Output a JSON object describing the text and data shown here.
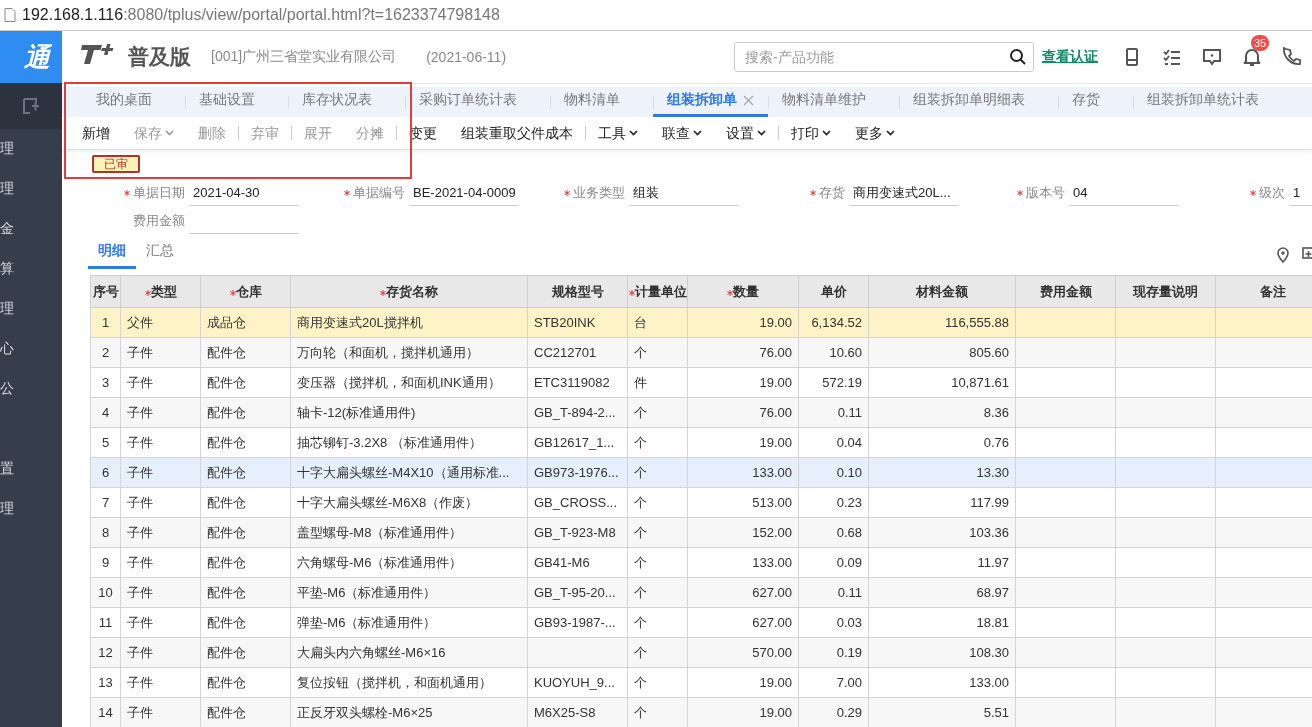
{
  "browser": {
    "url_host": "192.168.1.116",
    "url_rest": ":8080/tplus/view/portal/portal.html?t=1623374798148"
  },
  "sidebar": {
    "logo": "通",
    "groups": [
      [
        "理",
        "理",
        "金",
        "算",
        "理",
        "心",
        "公"
      ],
      [
        "置",
        "理"
      ]
    ]
  },
  "header": {
    "product": "普及版",
    "company": "[001]广州三省堂实业有限公司",
    "date": "(2021-06-11)",
    "search_placeholder": "搜索-产品功能",
    "link": "查看认证",
    "notification_count": "35"
  },
  "tabs": [
    {
      "label": "我的桌面",
      "selected": false,
      "closable": false
    },
    {
      "label": "基础设置",
      "selected": false,
      "closable": false
    },
    {
      "label": "库存状况表",
      "selected": false,
      "closable": false
    },
    {
      "label": "采购订单统计表",
      "selected": false,
      "closable": false
    },
    {
      "label": "物料清单",
      "selected": false,
      "closable": false
    },
    {
      "label": "组装拆卸单",
      "selected": true,
      "closable": true
    },
    {
      "label": "物料清单维护",
      "selected": false,
      "closable": false
    },
    {
      "label": "组装拆卸单明细表",
      "selected": false,
      "closable": false
    },
    {
      "label": "存货",
      "selected": false,
      "closable": false
    },
    {
      "label": "组装拆卸单统计表",
      "selected": false,
      "closable": false
    }
  ],
  "toolbar": [
    [
      {
        "label": "新增",
        "disabled": false,
        "dropdown": false
      },
      {
        "label": "保存",
        "disabled": true,
        "dropdown": true
      },
      {
        "label": "删除",
        "disabled": true,
        "dropdown": false
      }
    ],
    [
      {
        "label": "弃审",
        "disabled": true,
        "dropdown": false
      }
    ],
    [
      {
        "label": "展开",
        "disabled": true,
        "dropdown": false
      },
      {
        "label": "分摊",
        "disabled": true,
        "dropdown": false
      }
    ],
    [
      {
        "label": "变更",
        "disabled": false,
        "dropdown": false
      },
      {
        "label": "组装重取父件成本",
        "disabled": false,
        "dropdown": false
      }
    ],
    [
      {
        "label": "工具",
        "disabled": false,
        "dropdown": true
      },
      {
        "label": "联查",
        "disabled": false,
        "dropdown": true
      },
      {
        "label": "设置",
        "disabled": false,
        "dropdown": true
      }
    ],
    [
      {
        "label": "打印",
        "disabled": false,
        "dropdown": true
      },
      {
        "label": "更多",
        "disabled": false,
        "dropdown": true
      }
    ]
  ],
  "status": "已审",
  "form_rows": [
    [
      {
        "label": "单据日期",
        "value": "2021-04-30",
        "required": true
      },
      {
        "label": "单据编号",
        "value": "BE-2021-04-0009",
        "required": true
      },
      {
        "label": "业务类型",
        "value": "组装",
        "required": true
      },
      {
        "label": "存货",
        "value": "商用变速式20L...",
        "required": true
      },
      {
        "label": "版本号",
        "value": "04",
        "required": true
      },
      {
        "label": "级次",
        "value": "1",
        "required": true
      }
    ],
    [
      {
        "label": "费用金额",
        "required": false
      }
    ]
  ],
  "subtabs": [
    {
      "label": "明细",
      "selected": true
    },
    {
      "label": "汇总",
      "selected": false
    }
  ],
  "table": {
    "columns": [
      {
        "label": "序号",
        "required": false,
        "kind": "index"
      },
      {
        "label": "类型",
        "required": true,
        "kind": "text"
      },
      {
        "label": "仓库",
        "required": true,
        "kind": "text"
      },
      {
        "label": "存货名称",
        "required": true,
        "kind": "text"
      },
      {
        "label": "规格型号",
        "required": false,
        "kind": "text"
      },
      {
        "label": "计量单位",
        "required": true,
        "kind": "text"
      },
      {
        "label": "数量",
        "required": true,
        "kind": "number"
      },
      {
        "label": "单价",
        "required": false,
        "kind": "number"
      },
      {
        "label": "材料金额",
        "required": false,
        "kind": "number"
      },
      {
        "label": "费用金额",
        "required": false,
        "kind": "number"
      },
      {
        "label": "现存量说明",
        "required": false,
        "kind": "text"
      },
      {
        "label": "备注",
        "required": false,
        "kind": "text"
      }
    ],
    "rows": [
      {
        "kind": "parent",
        "selected": false,
        "cells": [
          "1",
          "父件",
          "成品仓",
          "商用变速式20L搅拌机",
          "STB20INK",
          "台",
          "19.00",
          "6,134.52",
          "116,555.88"
        ]
      },
      {
        "kind": "child",
        "selected": false,
        "cells": [
          "2",
          "子件",
          "配件仓",
          "万向轮（和面机，搅拌机通用）",
          "CC212701",
          "个",
          "76.00",
          "10.60",
          "805.60"
        ]
      },
      {
        "kind": "child",
        "selected": false,
        "cells": [
          "3",
          "子件",
          "配件仓",
          "变压器（搅拌机，和面机INK通用）",
          "ETC3119082",
          "件",
          "19.00",
          "572.19",
          "10,871.61"
        ]
      },
      {
        "kind": "child",
        "selected": false,
        "cells": [
          "4",
          "子件",
          "配件仓",
          "轴卡-12(标准通用件)",
          "GB_T-894-2...",
          "个",
          "76.00",
          "0.11",
          "8.36"
        ]
      },
      {
        "kind": "child",
        "selected": false,
        "cells": [
          "5",
          "子件",
          "配件仓",
          "抽芯铆钉-3.2X8 （标准通用件）",
          "GB12617_1...",
          "个",
          "19.00",
          "0.04",
          "0.76"
        ]
      },
      {
        "kind": "child",
        "selected": true,
        "cells": [
          "6",
          "子件",
          "配件仓",
          "十字大扁头螺丝-M4X10（通用标准...",
          "GB973-1976...",
          "个",
          "133.00",
          "0.10",
          "13.30"
        ]
      },
      {
        "kind": "child",
        "selected": false,
        "cells": [
          "7",
          "子件",
          "配件仓",
          "十字大扁头螺丝-M6X8（作废）",
          "GB_CROSS...",
          "个",
          "513.00",
          "0.23",
          "117.99"
        ]
      },
      {
        "kind": "child",
        "selected": false,
        "cells": [
          "8",
          "子件",
          "配件仓",
          "盖型螺母-M8（标准通用件）",
          "GB_T-923-M8",
          "个",
          "152.00",
          "0.68",
          "103.36"
        ]
      },
      {
        "kind": "child",
        "selected": false,
        "cells": [
          "9",
          "子件",
          "配件仓",
          "六角螺母-M6（标准通用件）",
          "GB41-M6",
          "个",
          "133.00",
          "0.09",
          "11.97"
        ]
      },
      {
        "kind": "child",
        "selected": false,
        "cells": [
          "10",
          "子件",
          "配件仓",
          "平垫-M6（标准通用件）",
          "GB_T-95-20...",
          "个",
          "627.00",
          "0.11",
          "68.97"
        ]
      },
      {
        "kind": "child",
        "selected": false,
        "cells": [
          "11",
          "子件",
          "配件仓",
          "弹垫-M6（标准通用件）",
          "GB93-1987-...",
          "个",
          "627.00",
          "0.03",
          "18.81"
        ]
      },
      {
        "kind": "child",
        "selected": false,
        "cells": [
          "12",
          "子件",
          "配件仓",
          "大扁头内六角螺丝-M6×16",
          null,
          "个",
          "570.00",
          "0.19",
          "108.30"
        ]
      },
      {
        "kind": "child",
        "selected": false,
        "cells": [
          "13",
          "子件",
          "配件仓",
          "复位按钮（搅拌机，和面机通用）",
          "KUOYUH_9...",
          "个",
          "19.00",
          "7.00",
          "133.00"
        ]
      },
      {
        "kind": "child",
        "selected": false,
        "cells": [
          "14",
          "子件",
          "配件仓",
          "正反牙双头螺栓-M6×25",
          "M6X25-S8",
          "个",
          "19.00",
          "0.29",
          "5.51"
        ]
      }
    ]
  }
}
